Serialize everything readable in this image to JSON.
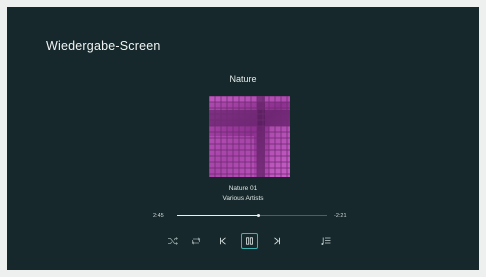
{
  "screen": {
    "title": "Wiedergabe-Screen"
  },
  "album": {
    "title": "Nature"
  },
  "track": {
    "title": "Nature 01",
    "artist": "Various Artists"
  },
  "progress": {
    "elapsed": "2:45",
    "remaining": "-2:21",
    "fraction": 0.54
  },
  "controls": {
    "shuffle_icon": "shuffle-icon",
    "repeat_icon": "repeat-icon",
    "previous_icon": "skip-previous-icon",
    "play_pause_icon": "pause-icon",
    "next_icon": "skip-next-icon",
    "queue_icon": "queue-icon"
  },
  "colors": {
    "background": "#16282b",
    "accent": "#3fb2b2",
    "artwork": "#a43aa6"
  }
}
